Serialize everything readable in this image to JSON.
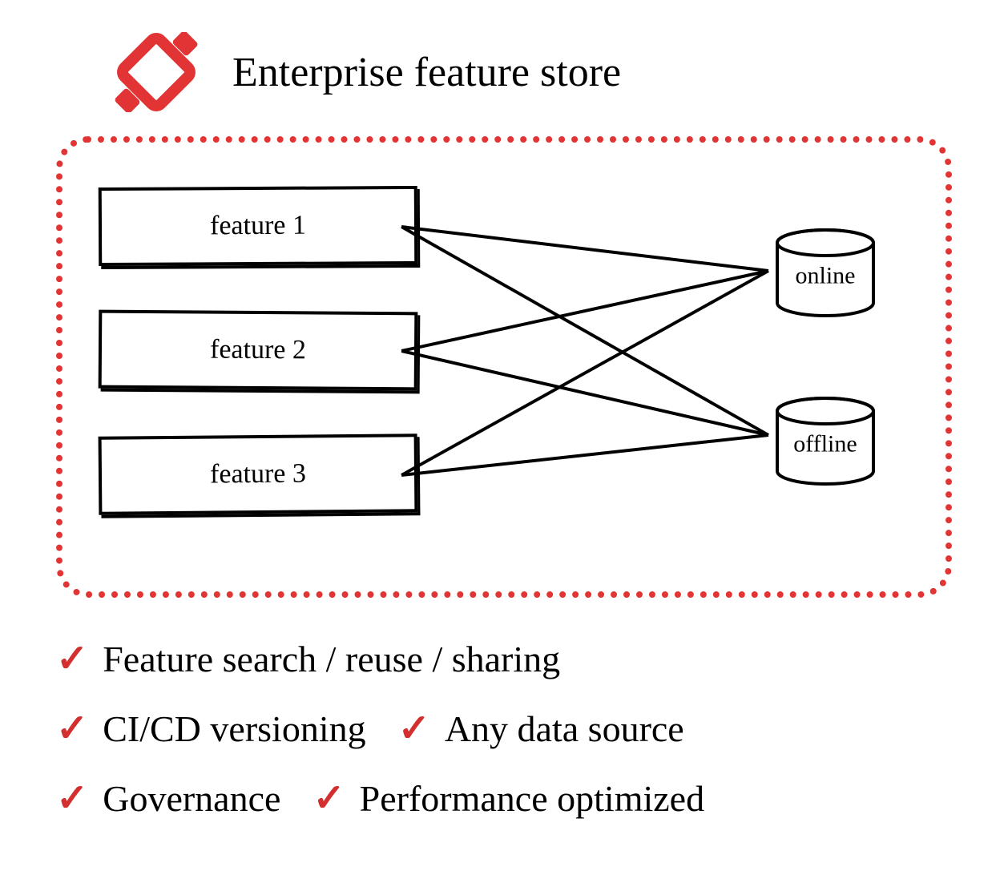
{
  "title": "Enterprise feature store",
  "features": {
    "f1": "feature 1",
    "f2": "feature 2",
    "f3": "feature 3"
  },
  "stores": {
    "online": "online",
    "offline": "offline"
  },
  "bullets": {
    "b1": "Feature search / reuse / sharing",
    "b2": "CI/CD versioning",
    "b3": "Any data source",
    "b4": "Governance",
    "b5": "Performance optimized"
  },
  "colors": {
    "accent": "#e23434",
    "check": "#d32f2f"
  }
}
